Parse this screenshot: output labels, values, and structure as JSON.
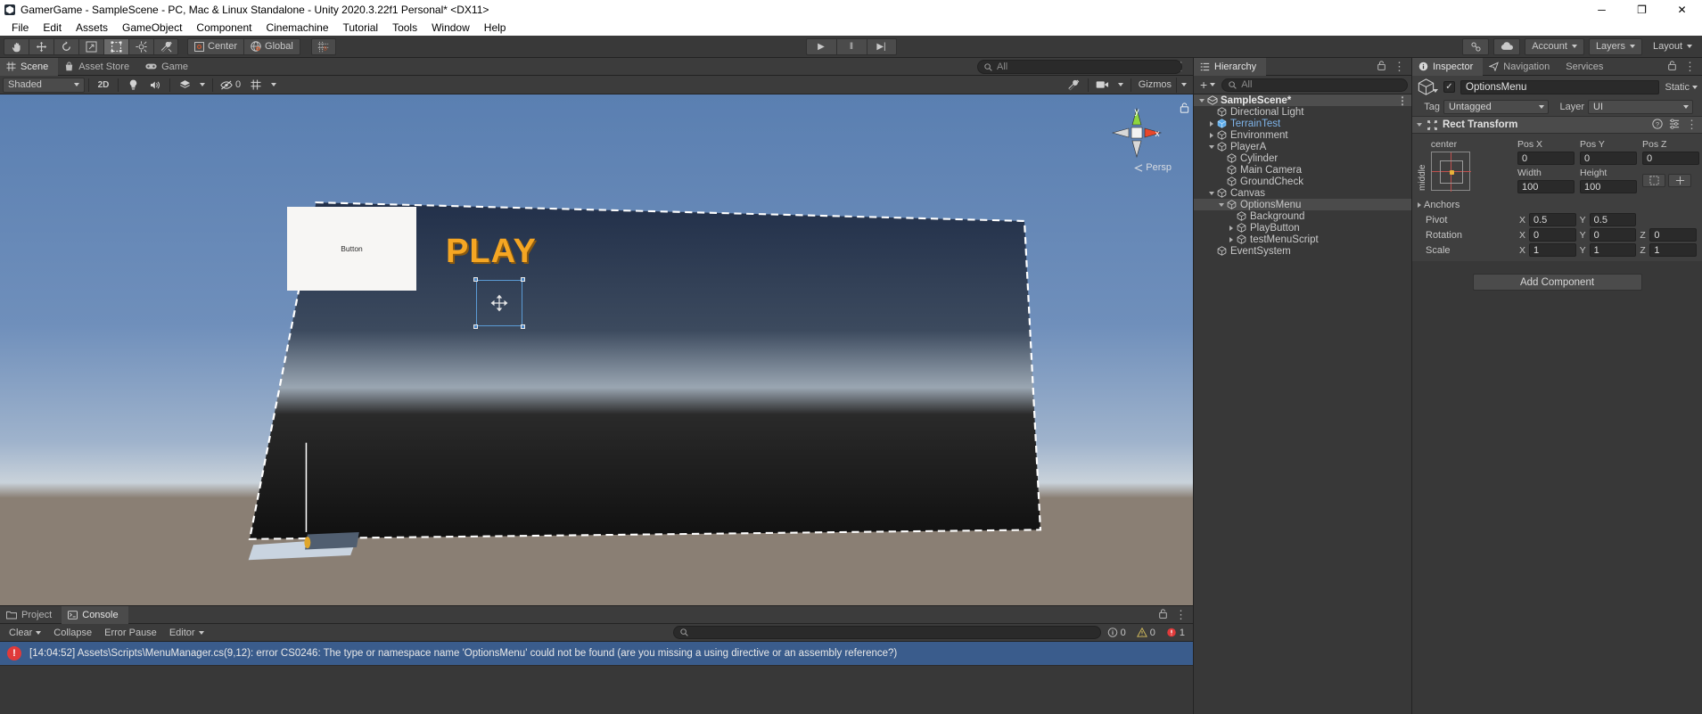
{
  "window": {
    "title": "GamerGame - SampleScene - PC, Mac & Linux Standalone - Unity 2020.3.22f1 Personal* <DX11>",
    "minimize": "─",
    "maximize": "❐",
    "close": "✕"
  },
  "menubar": [
    "File",
    "Edit",
    "Assets",
    "GameObject",
    "Component",
    "Cinemachine",
    "Tutorial",
    "Tools",
    "Window",
    "Help"
  ],
  "toolbar": {
    "tools": [
      {
        "name": "hand-tool",
        "glyph": "✋"
      },
      {
        "name": "move-tool",
        "glyph": "✥"
      },
      {
        "name": "rotate-tool",
        "glyph": "↻"
      },
      {
        "name": "scale-tool",
        "glyph": "↗"
      },
      {
        "name": "rect-tool",
        "glyph": "⬚"
      },
      {
        "name": "transform-tool",
        "glyph": "✣"
      },
      {
        "name": "custom-tool",
        "glyph": "⚒"
      }
    ],
    "pivot": "Center",
    "space": "Global",
    "snap": "⌗",
    "play": "▶",
    "pause": "‖",
    "step": "▶|",
    "cloud": "☁",
    "account": "Account",
    "layers": "Layers",
    "layout": "Layout",
    "collab": "⧉"
  },
  "scene_panel": {
    "tabs": [
      {
        "label": "Scene",
        "icon": "grid-icon",
        "selected": true
      },
      {
        "label": "Asset Store",
        "icon": "bag-icon",
        "selected": false
      },
      {
        "label": "Game",
        "icon": "gamepad-icon",
        "selected": false
      }
    ],
    "subtoolbar": {
      "draw_mode": "Shaded",
      "view_2d": "2D",
      "lighting": "Ὂ1",
      "audio": "ὐA",
      "effects": "✨",
      "hidden_count": "0",
      "grid": "⌗",
      "tools_icon": "⚒",
      "camera_icon": "὏7",
      "gizmos": "Gizmos",
      "search_placeholder": "All"
    },
    "gizmo": {
      "y_label": "y",
      "x_label": "x",
      "projection": "Persp",
      "lock": "ὑ2"
    },
    "objects": {
      "button_label": "Button",
      "play_label": "PLAY"
    }
  },
  "console_panel": {
    "tabs": [
      {
        "label": "Project",
        "icon": "folder-icon",
        "selected": false
      },
      {
        "label": "Console",
        "icon": "console-icon",
        "selected": true
      }
    ],
    "toolbar": {
      "clear": "Clear",
      "collapse": "Collapse",
      "error_pause": "Error Pause",
      "editor": "Editor",
      "search_placeholder": "",
      "log_count": "0",
      "warn_count": "0",
      "error_count": "1"
    },
    "messages": [
      {
        "severity": "error",
        "text": "[14:04:52] Assets\\Scripts\\MenuManager.cs(9,12): error CS0246: The type or namespace name 'OptionsMenu' could not be found (are you missing a using directive or an assembly reference?)"
      }
    ]
  },
  "hierarchy": {
    "title": "Hierarchy",
    "add_button": "+",
    "search_placeholder": "All",
    "lock_icon": "ὑ2",
    "kebab": "⋮",
    "items": [
      {
        "label": "SampleScene*",
        "depth": 0,
        "twist": "down",
        "type": "scene",
        "selected": false
      },
      {
        "label": "Directional Light",
        "depth": 1,
        "twist": "none",
        "type": "object",
        "selected": false
      },
      {
        "label": "TerrainTest",
        "depth": 1,
        "twist": "right",
        "type": "prefab",
        "selected": false
      },
      {
        "label": "Environment",
        "depth": 1,
        "twist": "right",
        "type": "object",
        "selected": false
      },
      {
        "label": "PlayerA",
        "depth": 1,
        "twist": "down",
        "type": "object",
        "selected": false
      },
      {
        "label": "Cylinder",
        "depth": 2,
        "twist": "none",
        "type": "object",
        "selected": false
      },
      {
        "label": "Main Camera",
        "depth": 2,
        "twist": "none",
        "type": "object",
        "selected": false
      },
      {
        "label": "GroundCheck",
        "depth": 2,
        "twist": "none",
        "type": "object",
        "selected": false
      },
      {
        "label": "Canvas",
        "depth": 1,
        "twist": "down",
        "type": "object",
        "selected": false
      },
      {
        "label": "OptionsMenu",
        "depth": 2,
        "twist": "down",
        "type": "object",
        "selected": true
      },
      {
        "label": "Background",
        "depth": 3,
        "twist": "none",
        "type": "object",
        "selected": false
      },
      {
        "label": "PlayButton",
        "depth": 3,
        "twist": "right",
        "type": "object",
        "selected": false
      },
      {
        "label": "testMenuScript",
        "depth": 3,
        "twist": "right",
        "type": "object",
        "selected": false
      },
      {
        "label": "EventSystem",
        "depth": 1,
        "twist": "none",
        "type": "object",
        "selected": false
      }
    ]
  },
  "inspector": {
    "tabs": [
      {
        "label": "Inspector",
        "icon": "info-icon",
        "selected": true
      },
      {
        "label": "Navigation",
        "icon": "nav-icon",
        "selected": false
      },
      {
        "label": "Services",
        "icon": "services-icon",
        "selected": false
      }
    ],
    "lock_icon": "ὑ2",
    "kebab": "⋮",
    "object_name": "OptionsMenu",
    "enabled": true,
    "static_label": "Static",
    "tag_label": "Tag",
    "tag_value": "Untagged",
    "layer_label": "Layer",
    "layer_value": "UI",
    "component": {
      "title": "Rect Transform",
      "help_icon": "?",
      "preset_icon": "⚙",
      "kebab": "⋮",
      "anchor_preset_h": "center",
      "anchor_preset_v": "middle",
      "pos_labels": [
        "Pos X",
        "Pos Y",
        "Pos Z"
      ],
      "pos_values": [
        "0",
        "0",
        "0"
      ],
      "size_labels": [
        "Width",
        "Height"
      ],
      "size_values": [
        "100",
        "100"
      ],
      "anchors_label": "Anchors",
      "pivot_label": "Pivot",
      "pivot": [
        {
          "axis": "X",
          "value": "0.5"
        },
        {
          "axis": "Y",
          "value": "0.5"
        }
      ],
      "rotation_label": "Rotation",
      "rotation": [
        {
          "axis": "X",
          "value": "0"
        },
        {
          "axis": "Y",
          "value": "0"
        },
        {
          "axis": "Z",
          "value": "0"
        }
      ],
      "scale_label": "Scale",
      "scale": [
        {
          "axis": "X",
          "value": "1"
        },
        {
          "axis": "Y",
          "value": "1"
        },
        {
          "axis": "Z",
          "value": "1"
        }
      ]
    },
    "add_component": "Add Component"
  }
}
